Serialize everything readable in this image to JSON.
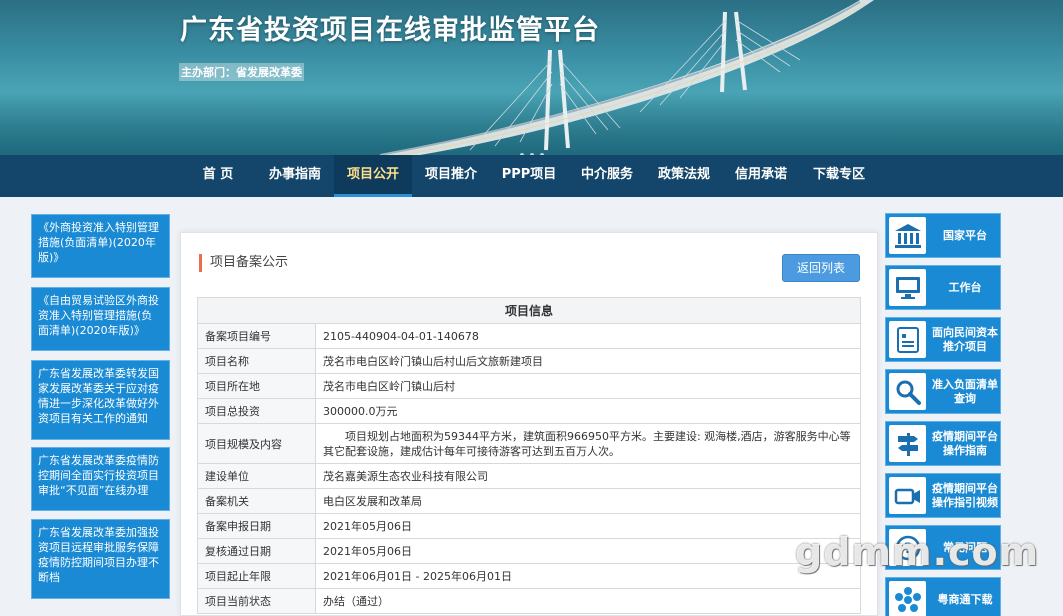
{
  "header": {
    "title": "广东省投资项目在线审批监管平台",
    "sponsor": "主办部门：省发展改革委"
  },
  "nav": {
    "items": [
      {
        "label": "首 页"
      },
      {
        "label": "办事指南"
      },
      {
        "label": "项目公开",
        "active": true
      },
      {
        "label": "项目推介"
      },
      {
        "label": "PPP项目"
      },
      {
        "label": "中介服务"
      },
      {
        "label": "政策法规"
      },
      {
        "label": "信用承诺"
      },
      {
        "label": "下载专区"
      }
    ]
  },
  "left_links": [
    {
      "text": "《外商投资准入特别管理措施(负面清单)(2020年版)》"
    },
    {
      "text": "《自由贸易试验区外商投资准入特别管理措施(负面清单)(2020年版)》"
    },
    {
      "text": "广东省发展改革委转发国家发展改革委关于应对疫情进一步深化改革做好外资项目有关工作的通知"
    },
    {
      "text": "广东省发展改革委疫情防控期间全面实行投资项目审批“不见面”在线办理"
    },
    {
      "text": "广东省发展改革委加强投资项目远程审批服务保障 疫情防控期间项目办理不断档"
    }
  ],
  "panel": {
    "title": "项目备案公示",
    "back_label": "返回列表",
    "table_header": "项目信息",
    "rows": [
      {
        "label": "备案项目编号",
        "value": "2105-440904-04-01-140678"
      },
      {
        "label": "项目名称",
        "value": "茂名市电白区岭门镇山后村山后文旅新建项目"
      },
      {
        "label": "项目所在地",
        "value": "茂名市电白区岭门镇山后村"
      },
      {
        "label": "项目总投资",
        "value": "300000.0万元"
      },
      {
        "label": "项目规模及内容",
        "value": "　　项目规划占地面积为59344平方米，建筑面积966950平方米。主要建设: 观海楼,酒店，游客服务中心等其它配套设施，建成估计每年可接待游客可达到五百万人次。"
      },
      {
        "label": "建设单位",
        "value": "茂名嘉美源生态农业科技有限公司"
      },
      {
        "label": "备案机关",
        "value": "电白区发展和改革局"
      },
      {
        "label": "备案申报日期",
        "value": "2021年05月06日"
      },
      {
        "label": "复核通过日期",
        "value": "2021年05月06日"
      },
      {
        "label": "项目起止年限",
        "value": "2021年06月01日 - 2025年06月01日"
      },
      {
        "label": "项目当前状态",
        "value": "办结（通过）"
      }
    ]
  },
  "right_links": [
    {
      "label": "国家平台",
      "icon": "building-icon"
    },
    {
      "label": "工作台",
      "icon": "monitor-icon"
    },
    {
      "label": "面向民间资本推介项目",
      "icon": "document-chart-icon"
    },
    {
      "label": "准入负面清单查询",
      "icon": "magnifier-icon"
    },
    {
      "label": "疫情期间平台操作指南",
      "icon": "signpost-icon"
    },
    {
      "label": "疫情期间平台操作指引视频",
      "icon": "video-camera-icon"
    },
    {
      "label": "常见问题",
      "icon": "question-icon"
    },
    {
      "label": "粤商通下载",
      "icon": "app-logo-icon"
    }
  ],
  "watermark": "gdmm.com",
  "colors": {
    "nav_bg": "#14456a",
    "accent_blue": "#1a8ad4",
    "button_blue": "#4c9be0",
    "title_marker": "#e8704a"
  }
}
